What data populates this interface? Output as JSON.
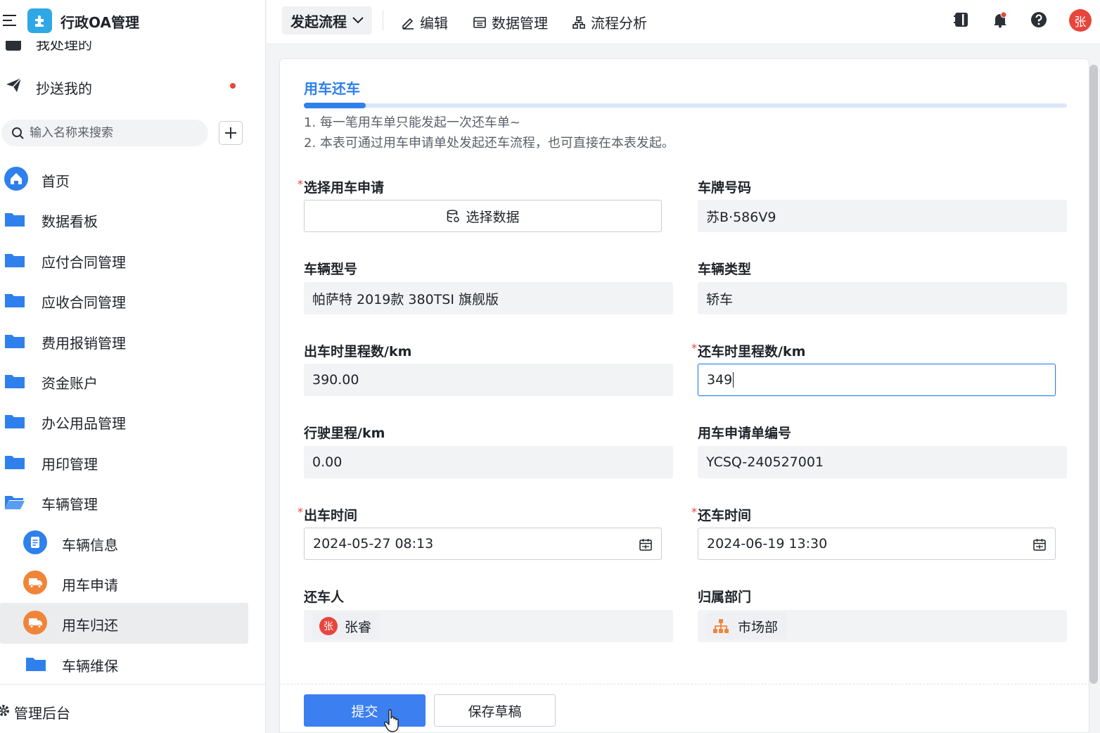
{
  "app": {
    "title": "行政OA管理"
  },
  "sidebar": {
    "partial_item_label": "我处理的",
    "cc_item_label": "抄送我的",
    "search_placeholder": "输入名称来搜索",
    "nav": [
      {
        "label": "首页",
        "icon": "home-icon"
      },
      {
        "label": "数据看板",
        "icon": "folder-icon"
      },
      {
        "label": "应付合同管理",
        "icon": "folder-icon"
      },
      {
        "label": "应收合同管理",
        "icon": "folder-icon"
      },
      {
        "label": "费用报销管理",
        "icon": "folder-icon"
      },
      {
        "label": "资金账户",
        "icon": "folder-icon"
      },
      {
        "label": "办公用品管理",
        "icon": "folder-icon"
      },
      {
        "label": "用印管理",
        "icon": "folder-icon"
      },
      {
        "label": "车辆管理",
        "icon": "folder-open-icon"
      },
      {
        "label": "车辆信息",
        "icon": "document-icon"
      },
      {
        "label": "用车申请",
        "icon": "truck-icon"
      },
      {
        "label": "用车归还",
        "icon": "truck-icon"
      },
      {
        "label": "车辆维保",
        "icon": "folder-icon"
      }
    ],
    "admin_label": "管理后台"
  },
  "topbar": {
    "start_flow": "发起流程",
    "edit": "编辑",
    "data_manage": "数据管理",
    "flow_analysis": "流程分析",
    "avatar_text": "张"
  },
  "form": {
    "title": "用车还车",
    "notes": [
      "1. 每一笔用车单只能发起一次还车单~",
      "2. 本表可通过用车申请单处发起还车流程，也可直接在本表发起。"
    ],
    "fields": {
      "select_request": {
        "label": "选择用车申请",
        "button": "选择数据"
      },
      "plate": {
        "label": "车牌号码",
        "value": "苏B·586V9"
      },
      "model": {
        "label": "车辆型号",
        "value": "帕萨特 2019款 380TSI 旗舰版"
      },
      "vtype": {
        "label": "车辆类型",
        "value": "轿车"
      },
      "out_mileage": {
        "label": "出车时里程数/km",
        "value": "390.00"
      },
      "return_mileage": {
        "label": "还车时里程数/km",
        "value": "349"
      },
      "distance": {
        "label": "行驶里程/km",
        "value": "0.00"
      },
      "request_no": {
        "label": "用车申请单编号",
        "value": "YCSQ-240527001"
      },
      "out_time": {
        "label": "出车时间",
        "value": "2024-05-27 08:13"
      },
      "return_time": {
        "label": "还车时间",
        "value": "2024-06-19 13:30"
      },
      "returner": {
        "label": "还车人",
        "value": "张睿",
        "avatar": "张"
      },
      "department": {
        "label": "归属部门",
        "value": "市场部"
      }
    },
    "submit": "提交",
    "save_draft": "保存草稿"
  },
  "colors": {
    "primary": "#3b7ff0",
    "required": "#e8453c",
    "folder": "#2f80ed",
    "truck": "#f0853a"
  }
}
